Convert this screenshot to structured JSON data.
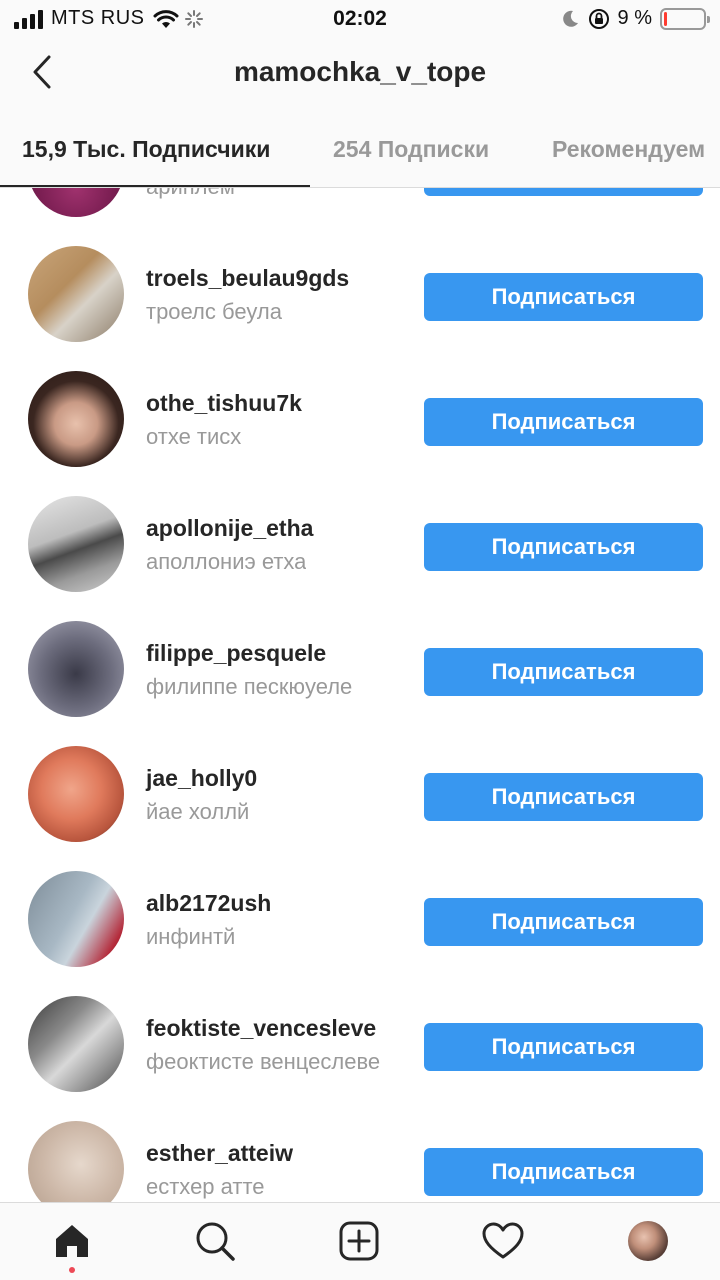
{
  "status_bar": {
    "carrier": "MTS RUS",
    "time": "02:02",
    "battery_percent": "9 %",
    "battery_level": 0.09
  },
  "header": {
    "title": "mamochka_v_tope"
  },
  "tabs": {
    "followers": "15,9 Тыс. Подписчики",
    "following": "254 Подписки",
    "recommended": "Рекомендуем"
  },
  "follow_label": "Подписаться",
  "followers": [
    {
      "username": "",
      "fullname": "ариплем"
    },
    {
      "username": "troels_beulau9gds",
      "fullname": "троелс беула"
    },
    {
      "username": "othe_tishuu7k",
      "fullname": "отхе тисх"
    },
    {
      "username": "apollonije_etha",
      "fullname": "аполлониэ етха"
    },
    {
      "username": "filippe_pesquele",
      "fullname": "филиппе пескюуеле"
    },
    {
      "username": "jae_holly0",
      "fullname": "йае холлй"
    },
    {
      "username": "alb2172ush",
      "fullname": "инфинтй"
    },
    {
      "username": "feoktiste_vencesleve",
      "fullname": "феоктисте венцеслеве"
    },
    {
      "username": "esther_atteiw",
      "fullname": "естхер атте"
    }
  ],
  "colors": {
    "accent": "#3897f0",
    "text_primary": "#262626",
    "text_secondary": "#999999",
    "notification": "#ed4956"
  },
  "icons": {
    "back": "chevron-left-icon",
    "home": "home-icon",
    "search": "search-icon",
    "add": "plus-square-icon",
    "activity": "heart-icon",
    "profile": "profile-avatar"
  }
}
